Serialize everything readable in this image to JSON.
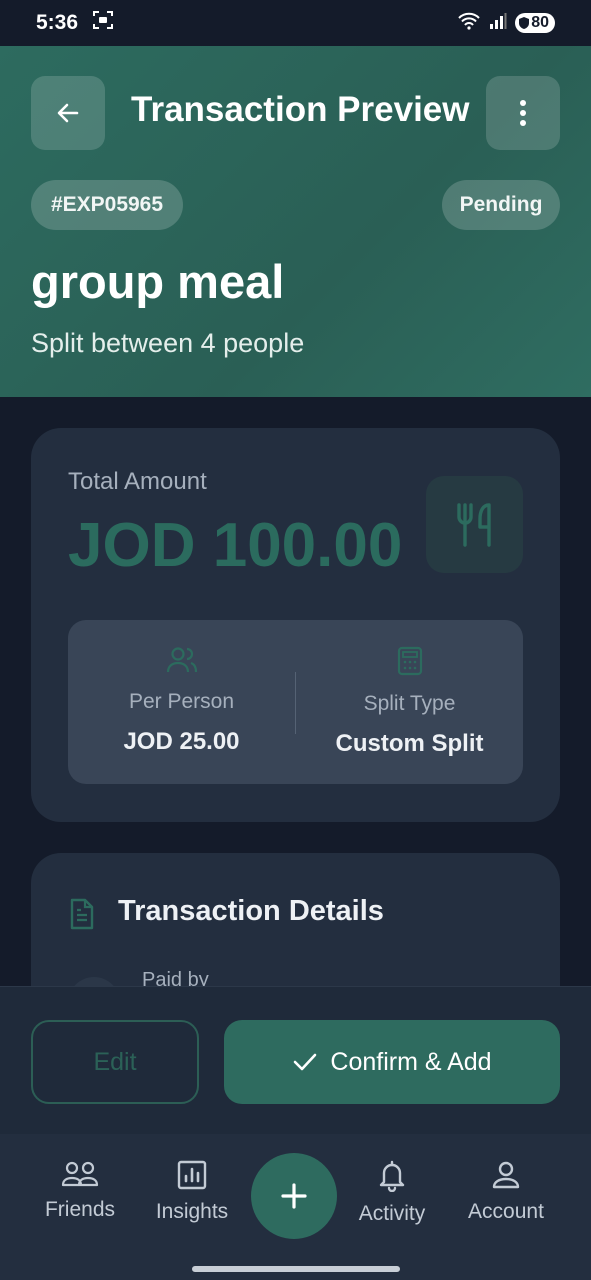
{
  "status": {
    "time": "5:36",
    "battery": "80"
  },
  "header": {
    "title": "Transaction Preview",
    "id_badge": "#EXP05965",
    "status_badge": "Pending",
    "name": "group meal",
    "subtitle": "Split between 4 people",
    "back_icon": "arrow-left-icon",
    "menu_icon": "more-vertical-icon"
  },
  "amount": {
    "label": "Total Amount",
    "value": "JOD 100.00",
    "category_icon": "utensils-icon",
    "per_person_label": "Per Person",
    "per_person_value": "JOD 25.00",
    "split_type_label": "Split Type",
    "split_type_value": "Custom Split"
  },
  "details": {
    "title": "Transaction Details",
    "paid_by_label": "Paid by"
  },
  "actions": {
    "edit_label": "Edit",
    "confirm_label": "Confirm & Add"
  },
  "nav": {
    "items": [
      {
        "label": "Friends",
        "icon": "users-icon"
      },
      {
        "label": "Insights",
        "icon": "chart-icon"
      },
      {
        "label": "Activity",
        "icon": "bell-icon"
      },
      {
        "label": "Account",
        "icon": "user-icon"
      }
    ],
    "fab_icon": "plus-icon"
  },
  "colors": {
    "accent": "#2e6b5f",
    "background": "#141b2a",
    "card": "#232e3f"
  }
}
